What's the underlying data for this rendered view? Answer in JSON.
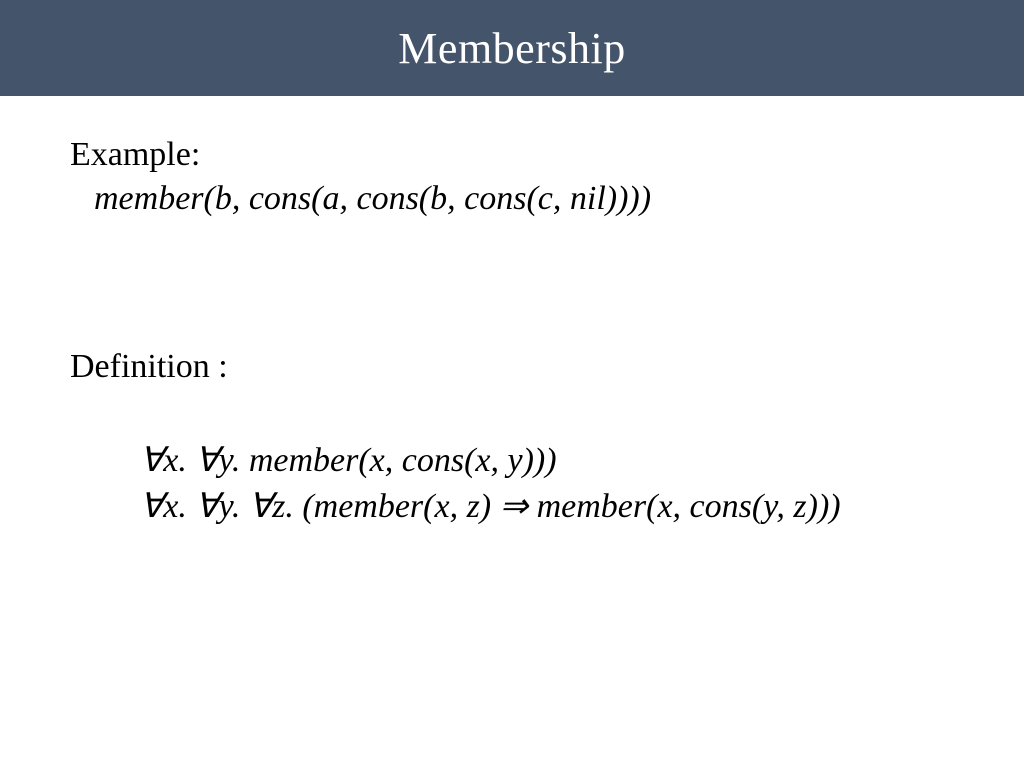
{
  "title": "Membership",
  "example": {
    "label": "Example:",
    "expression": "member(b, cons(a, cons(b, cons(c, nil))))"
  },
  "definition": {
    "label": "Definition :",
    "lines": [
      "∀x. ∀y. member(x, cons(x, y)))",
      "∀x. ∀y. ∀z. (member(x, z) ⇒ member(x, cons(y, z)))"
    ]
  }
}
